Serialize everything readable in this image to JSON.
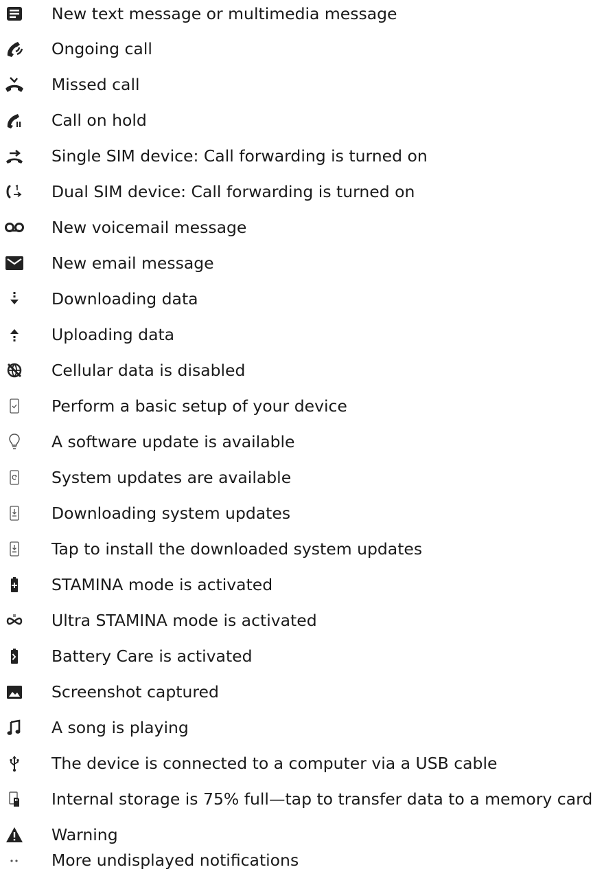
{
  "items": [
    {
      "icon": "text-message-icon",
      "label": "New text message or multimedia message"
    },
    {
      "icon": "ongoing-call-icon",
      "label": "Ongoing call"
    },
    {
      "icon": "missed-call-icon",
      "label": "Missed call"
    },
    {
      "icon": "call-on-hold-icon",
      "label": "Call on hold"
    },
    {
      "icon": "call-forwarding-icon",
      "label": "Single SIM device: Call forwarding is turned on"
    },
    {
      "icon": "dual-sim-call-forwarding-icon",
      "label": "Dual SIM device: Call forwarding is turned on"
    },
    {
      "icon": "voicemail-icon",
      "label": "New voicemail message"
    },
    {
      "icon": "email-icon",
      "label": "New email message"
    },
    {
      "icon": "download-icon",
      "label": "Downloading data"
    },
    {
      "icon": "upload-icon",
      "label": "Uploading data"
    },
    {
      "icon": "cellular-data-disabled-icon",
      "label": "Cellular data is disabled"
    },
    {
      "icon": "basic-setup-icon",
      "label": "Perform a basic setup of your device"
    },
    {
      "icon": "lightbulb-icon",
      "label": "A software update is available"
    },
    {
      "icon": "system-update-available-icon",
      "label": "System updates are available"
    },
    {
      "icon": "downloading-system-update-icon",
      "label": "Downloading system updates"
    },
    {
      "icon": "install-system-update-icon",
      "label": "Tap to install the downloaded system updates"
    },
    {
      "icon": "stamina-battery-icon",
      "label": "STAMINA mode is activated"
    },
    {
      "icon": "ultra-stamina-icon",
      "label": "Ultra STAMINA mode is activated"
    },
    {
      "icon": "battery-care-icon",
      "label": "Battery Care is activated"
    },
    {
      "icon": "screenshot-icon",
      "label": "Screenshot captured"
    },
    {
      "icon": "music-note-icon",
      "label": "A song is playing"
    },
    {
      "icon": "usb-icon",
      "label": "The device is connected to a computer via a USB cable"
    },
    {
      "icon": "storage-sd-card-icon",
      "label": "Internal storage is 75% full—tap to transfer data to a memory card"
    },
    {
      "icon": "warning-icon",
      "label": "Warning"
    },
    {
      "icon": "more-notifications-icon",
      "label": "More undisplayed notifications"
    }
  ]
}
